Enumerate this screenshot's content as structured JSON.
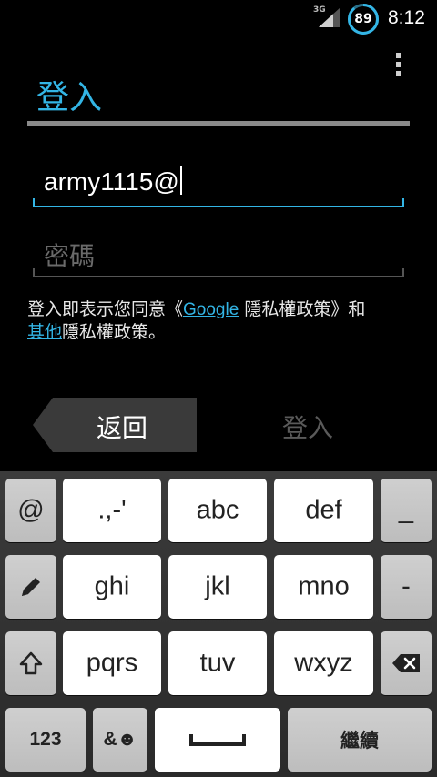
{
  "status_bar": {
    "network_type": "3G",
    "battery_percent": "89",
    "time": "8:12"
  },
  "header": {
    "title": "登入"
  },
  "form": {
    "email_value": "army1115@",
    "password_placeholder": "密碼"
  },
  "privacy": {
    "text_prefix": "登入即表示您同意《",
    "google_link": "Google",
    "text_middle": " 隱私權政策》和",
    "other_link": "其他",
    "text_suffix": "隱私權政策。"
  },
  "navigation": {
    "back_label": "返回",
    "signin_label": "登入"
  },
  "keyboard": {
    "row1": {
      "left": "@",
      "k1": ".,-'",
      "k2": "abc",
      "k3": "def",
      "right": "_"
    },
    "row2": {
      "k1": "ghi",
      "k2": "jkl",
      "k3": "mno",
      "right": "-"
    },
    "row3": {
      "k1": "pqrs",
      "k2": "tuv",
      "k3": "wxyz"
    },
    "row4": {
      "numbers": "123",
      "symbols": "&☻",
      "done": "繼續"
    }
  },
  "colors": {
    "accent": "#33b5e5",
    "background": "#000000",
    "disabled_text": "#5a5a5a"
  }
}
